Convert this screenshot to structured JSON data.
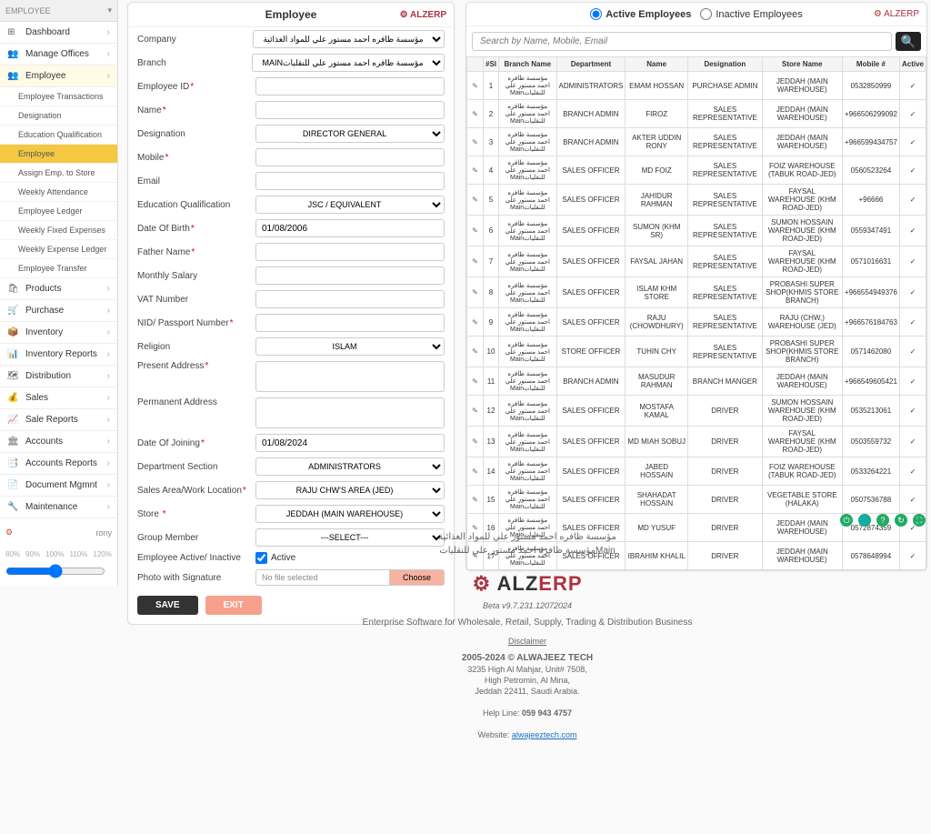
{
  "sidebar": {
    "header": "EMPLOYEE",
    "items": [
      {
        "label": "Dashboard",
        "icon": "⊞"
      },
      {
        "label": "Manage Offices",
        "icon": "👥"
      },
      {
        "label": "Employee",
        "icon": "👥",
        "active": true,
        "subs": [
          {
            "label": "Employee Transactions"
          },
          {
            "label": "Designation"
          },
          {
            "label": "Education Qualification"
          },
          {
            "label": "Employee",
            "active": true
          },
          {
            "label": "Assign Emp. to Store"
          },
          {
            "label": "Weekly Attendance"
          },
          {
            "label": "Employee Ledger"
          },
          {
            "label": "Weekly Fixed Expenses"
          },
          {
            "label": "Weekly Expense Ledger"
          },
          {
            "label": "Employee Transfer"
          }
        ]
      },
      {
        "label": "Products",
        "icon": "🛍"
      },
      {
        "label": "Purchase",
        "icon": "🛒"
      },
      {
        "label": "Inventory",
        "icon": "📦"
      },
      {
        "label": "Inventory Reports",
        "icon": "📊"
      },
      {
        "label": "Distribution",
        "icon": "🗺"
      },
      {
        "label": "Sales",
        "icon": "💰"
      },
      {
        "label": "Sale Reports",
        "icon": "📈"
      },
      {
        "label": "Accounts",
        "icon": "🏛"
      },
      {
        "label": "Accounts Reports",
        "icon": "📑"
      },
      {
        "label": "Document Mgmnt",
        "icon": "📄"
      },
      {
        "label": "Maintenance",
        "icon": "🔧"
      }
    ],
    "user": "rony",
    "zoom": [
      "80%",
      "90%",
      "100%",
      "110%",
      "120%"
    ]
  },
  "form": {
    "title": "Employee",
    "brand": "⚙ ALZERP",
    "company": {
      "label": "Company",
      "value": "مؤسسة ظافره احمد مستور علي للمواد الغذائية"
    },
    "branch": {
      "label": "Branch",
      "value": "MAINمؤسسة ظافره احمد مستور علي للنقليات"
    },
    "employee_id": {
      "label": "Employee ID"
    },
    "name": {
      "label": "Name"
    },
    "designation": {
      "label": "Designation",
      "value": "DIRECTOR GENERAL"
    },
    "mobile": {
      "label": "Mobile"
    },
    "email": {
      "label": "Email"
    },
    "education": {
      "label": "Education Qualification",
      "value": "JSC / EQUIVALENT"
    },
    "dob": {
      "label": "Date Of Birth",
      "value": "01/08/2006"
    },
    "father": {
      "label": "Father Name"
    },
    "salary": {
      "label": "Monthly Salary"
    },
    "vat": {
      "label": "VAT Number"
    },
    "nid": {
      "label": "NID/ Passport Number"
    },
    "religion": {
      "label": "Religion",
      "value": "ISLAM"
    },
    "present_addr": {
      "label": "Present Address"
    },
    "perm_addr": {
      "label": "Permanent Address"
    },
    "doj": {
      "label": "Date Of Joining",
      "value": "01/08/2024"
    },
    "department": {
      "label": "Department Section",
      "value": "ADMINISTRATORS"
    },
    "sales_area": {
      "label": "Sales Area/Work Location",
      "value": "RAJU CHW'S AREA (JED)"
    },
    "store": {
      "label": "Store",
      "value": "JEDDAH (MAIN WAREHOUSE)"
    },
    "group": {
      "label": "Group Member",
      "value": "---SELECT---"
    },
    "active": {
      "label": "Employee Active/ Inactive",
      "checkbox": "Active"
    },
    "photo": {
      "label": "Photo with Signature",
      "file_none": "No file selected",
      "choose": "Choose"
    },
    "buttons": {
      "save": "SAVE",
      "exit": "EXIT"
    }
  },
  "list": {
    "brand": "⚙ ALZERP",
    "radio_active": "Active Employees",
    "radio_inactive": "Inactive Employees",
    "search_placeholder": "Search by Name, Mobile, Email",
    "headers": [
      "#Sl",
      "Branch Name",
      "Department",
      "Name",
      "Designation",
      "Store Name",
      "Mobile #",
      "Active"
    ],
    "branch_text": "مؤسسة ظافره احمد مستور علي للنقلياتMain",
    "rows": [
      {
        "sl": "1",
        "dept": "ADMINISTRATORS",
        "name": "EMAM HOSSAN",
        "desg": "PURCHASE ADMIN",
        "store": "JEDDAH (MAIN WAREHOUSE)",
        "mobile": "0532850999"
      },
      {
        "sl": "2",
        "dept": "BRANCH ADMIN",
        "name": "FIROZ",
        "desg": "SALES REPRESENTATIVE",
        "store": "JEDDAH (MAIN WAREHOUSE)",
        "mobile": "+966506299092"
      },
      {
        "sl": "3",
        "dept": "BRANCH ADMIN",
        "name": "AKTER UDDIN RONY",
        "desg": "SALES REPRESENTATIVE",
        "store": "JEDDAH (MAIN WAREHOUSE)",
        "mobile": "+966599434757"
      },
      {
        "sl": "4",
        "dept": "SALES OFFICER",
        "name": "MD FOIZ",
        "desg": "SALES REPRESENTATIVE",
        "store": "FOIZ WAREHOUSE (TABUK ROAD-JED)",
        "mobile": "0560523264"
      },
      {
        "sl": "5",
        "dept": "SALES OFFICER",
        "name": "JAHIDUR RAHMAN",
        "desg": "SALES REPRESENTATIVE",
        "store": "FAYSAL WAREHOUSE (KHM ROAD-JED)",
        "mobile": "+96666"
      },
      {
        "sl": "6",
        "dept": "SALES OFFICER",
        "name": "SUMON (KHM SR)",
        "desg": "SALES REPRESENTATIVE",
        "store": "SUMON HOSSAIN WAREHOUSE (KHM ROAD-JED)",
        "mobile": "0559347491"
      },
      {
        "sl": "7",
        "dept": "SALES OFFICER",
        "name": "FAYSAL JAHAN",
        "desg": "SALES REPRESENTATIVE",
        "store": "FAYSAL WAREHOUSE (KHM ROAD-JED)",
        "mobile": "0571016631"
      },
      {
        "sl": "8",
        "dept": "SALES OFFICER",
        "name": "ISLAM KHM STORE",
        "desg": "SALES REPRESENTATIVE",
        "store": "PROBASHI SUPER SHOP(KHMIS STORE BRANCH)",
        "mobile": "+966554949376"
      },
      {
        "sl": "9",
        "dept": "SALES OFFICER",
        "name": "RAJU (CHOWDHURY)",
        "desg": "SALES REPRESENTATIVE",
        "store": "RAJU (CHW,) WAREHOUSE (JED)",
        "mobile": "+966576184763"
      },
      {
        "sl": "10",
        "dept": "STORE OFFICER",
        "name": "TUHIN CHY",
        "desg": "SALES REPRESENTATIVE",
        "store": "PROBASHI SUPER SHOP(KHMIS STORE BRANCH)",
        "mobile": "0571462080"
      },
      {
        "sl": "11",
        "dept": "BRANCH ADMIN",
        "name": "MASUDUR RAHMAN",
        "desg": "BRANCH MANGER",
        "store": "JEDDAH (MAIN WAREHOUSE)",
        "mobile": "+966549605421"
      },
      {
        "sl": "12",
        "dept": "SALES OFFICER",
        "name": "MOSTAFA KAMAL",
        "desg": "DRIVER",
        "store": "SUMON HOSSAIN WAREHOUSE (KHM ROAD-JED)",
        "mobile": "0535213061"
      },
      {
        "sl": "13",
        "dept": "SALES OFFICER",
        "name": "MD MIAH SOBUJ",
        "desg": "DRIVER",
        "store": "FAYSAL WAREHOUSE (KHM ROAD-JED)",
        "mobile": "0503559732"
      },
      {
        "sl": "14",
        "dept": "SALES OFFICER",
        "name": "JABED HOSSAIN",
        "desg": "DRIVER",
        "store": "FOIZ WAREHOUSE (TABUK ROAD-JED)",
        "mobile": "0533264221"
      },
      {
        "sl": "15",
        "dept": "SALES OFFICER",
        "name": "SHAHADAT HOSSAIN",
        "desg": "DRIVER",
        "store": "VEGETABLE STORE (HALAKA)",
        "mobile": "0507536788"
      },
      {
        "sl": "16",
        "dept": "SALES OFFICER",
        "name": "MD YUSUF",
        "desg": "DRIVER",
        "store": "JEDDAH (MAIN WAREHOUSE)",
        "mobile": "0572874359"
      },
      {
        "sl": "17",
        "dept": "SALES OFFICER",
        "name": "IBRAHIM KHALIL",
        "desg": "DRIVER",
        "store": "JEDDAH (MAIN WAREHOUSE)",
        "mobile": "0578648994"
      }
    ]
  },
  "footer": {
    "arabic1": "مؤسسة ظافره احمد مستور علي للمواد الغذائية",
    "arabic2": "Mainمؤسسة ظافره احمد مستور علي للنقليات",
    "brand_prefix": "⚙ ",
    "brand1": "ALZ",
    "brand2": "ERP",
    "beta": "Beta v9.7.231.12072024",
    "tagline": "Enterprise Software for Wholesale, Retail, Supply, Trading & Distribution Business",
    "disclaimer": "Disclaimer",
    "company": "2005-2024 © ALWAJEEZ TECH",
    "addr1": "3235 High Al Mahjar, Unit# 7508,",
    "addr2": "High Petromin, Al Mina,",
    "addr3": "Jeddah 22411, Saudi Arabia.",
    "help_label": "Help Line: ",
    "help_phone": "059 943 4757",
    "website_label": "Website: ",
    "website": "alwajeeztech.com"
  }
}
